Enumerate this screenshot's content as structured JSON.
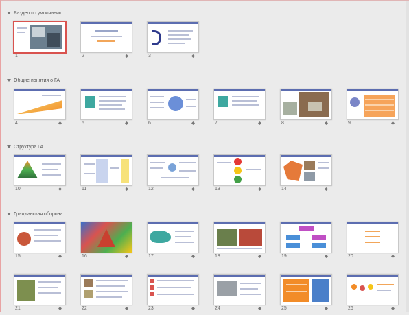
{
  "sections": [
    {
      "title": "Раздел по умолчанию"
    },
    {
      "title": "Общие понятия о ГА"
    },
    {
      "title": "Структура ГА"
    },
    {
      "title": "Гражданская оборона"
    }
  ],
  "slides": [
    "1",
    "2",
    "3",
    "4",
    "5",
    "6",
    "7",
    "8",
    "9",
    "10",
    "11",
    "12",
    "13",
    "14",
    "15",
    "16",
    "17",
    "18",
    "19",
    "20",
    "21",
    "22",
    "23",
    "24",
    "25",
    "26"
  ],
  "selected_slide": "1",
  "colors": {
    "selection": "#d9534f",
    "accent": "#5c6db0",
    "orange": "#f28c28",
    "red_light": "#e53935",
    "yellow_light": "#f5c518",
    "green_light": "#43a047"
  }
}
